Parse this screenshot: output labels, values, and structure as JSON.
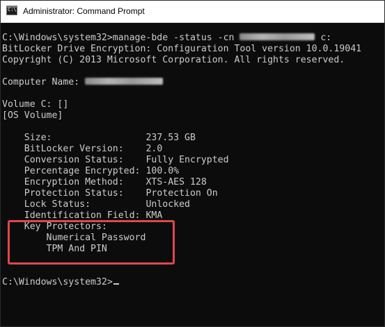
{
  "window": {
    "title": "Administrator: Command Prompt",
    "icon_glyph": "C:\\.",
    "icon": "cmd-icon"
  },
  "console": {
    "prompt_cmd": "C:\\Windows\\system32>manage-bde -status -cn ",
    "prompt_cmd_tail": " c:",
    "tool_line": "BitLocker Drive Encryption: Configuration Tool version 10.0.19041",
    "copyright": "Copyright (C) 2013 Microsoft Corporation. All rights reserved.",
    "computer_name_label": "Computer Name: ",
    "volume_line": "Volume C: []",
    "volume_type": "[OS Volume]",
    "fields": [
      {
        "label": "    Size:                 ",
        "value": "237.53 GB"
      },
      {
        "label": "    BitLocker Version:    ",
        "value": "2.0"
      },
      {
        "label": "    Conversion Status:    ",
        "value": "Fully Encrypted"
      },
      {
        "label": "    Percentage Encrypted: ",
        "value": "100.0%"
      },
      {
        "label": "    Encryption Method:    ",
        "value": "XTS-AES 128"
      },
      {
        "label": "    Protection Status:    ",
        "value": "Protection On"
      },
      {
        "label": "    Lock Status:          ",
        "value": "Unlocked"
      },
      {
        "label": "    Identification Field: ",
        "value": "KMA"
      }
    ],
    "key_protectors_label": "    Key Protectors:",
    "key_protectors": [
      "        Numerical Password",
      "        TPM And PIN"
    ],
    "final_prompt": "C:\\Windows\\system32>"
  },
  "colors": {
    "console_bg": "#0c0c0c",
    "console_text": "#cccccc",
    "highlight_border": "#e0484c"
  }
}
